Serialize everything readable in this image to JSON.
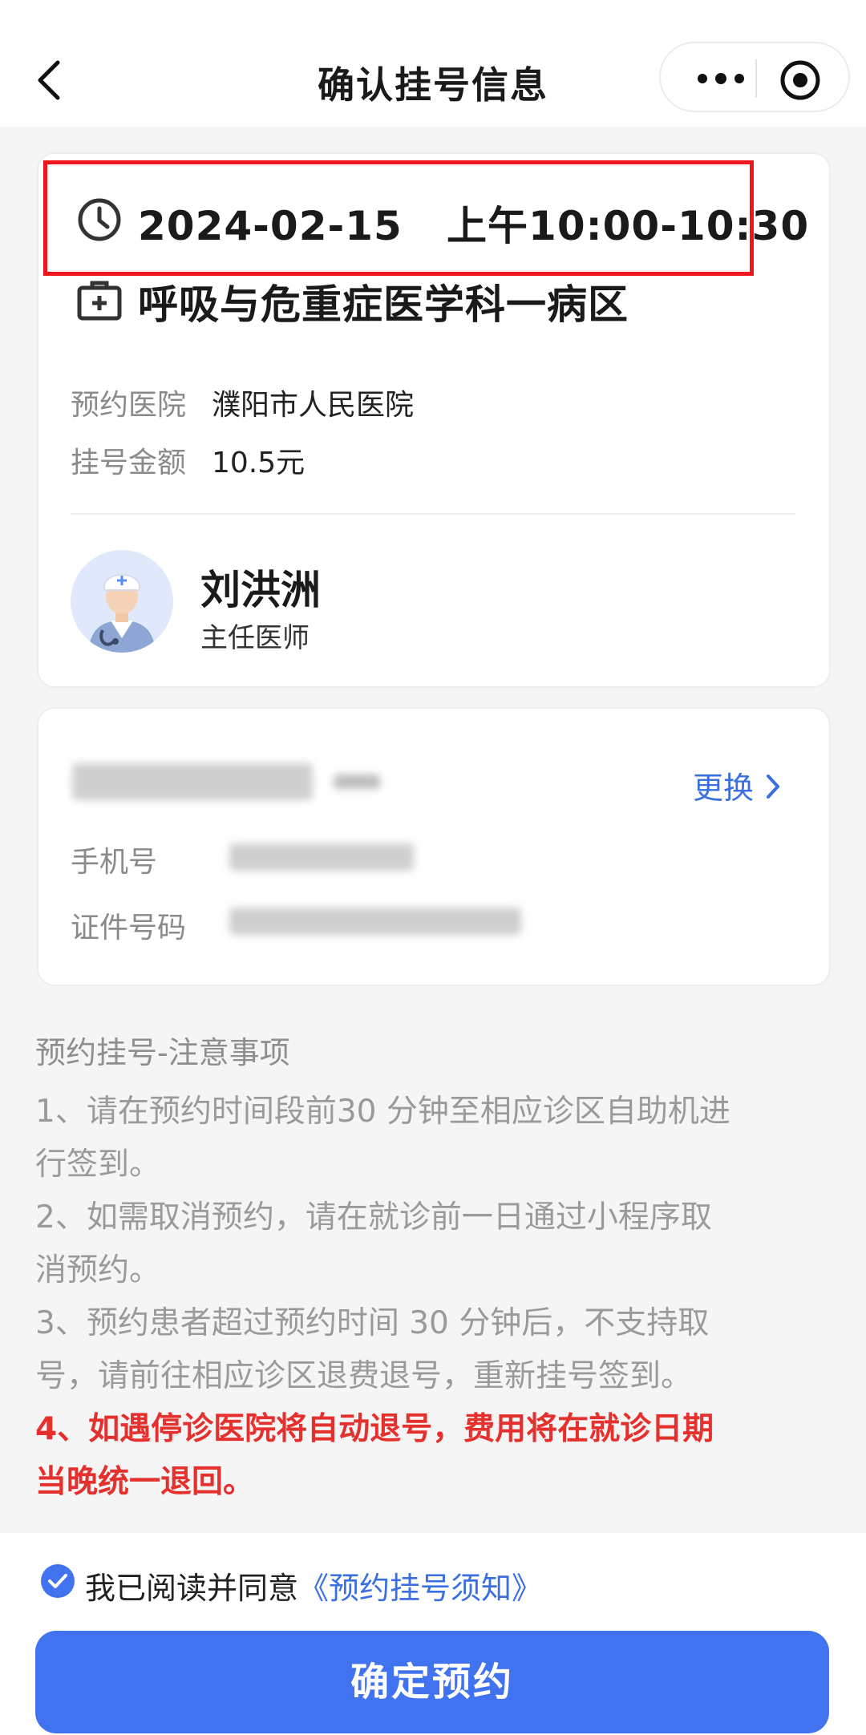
{
  "nav": {
    "title": "确认挂号信息"
  },
  "appointment": {
    "time": "2024-02-15   上午10:00-10:30",
    "department": "呼吸与危重症医学科一病区",
    "hospital_label": "预约医院",
    "hospital_value": "濮阳市人民医院",
    "fee_label": "挂号金额",
    "fee_value": "10.5元"
  },
  "doctor": {
    "name": "刘洪洲",
    "title": "主任医师"
  },
  "patient": {
    "change_label": "更换",
    "phone_label": "手机号",
    "id_label": "证件号码"
  },
  "notice": {
    "title": "预约挂号-注意事项",
    "items": [
      "1、请在预约时间段前30 分钟至相应诊区自助机进",
      "行签到。",
      "2、如需取消预约，请在就诊前一日通过小程序取",
      "消预约。",
      "3、预约患者超过预约时间 30 分钟后，不支持取",
      "号，请前往相应诊区退费退号，重新挂号签到。",
      "4、如遇停诊医院将自动退号，费用将在就诊日期",
      "当晚统一退回。"
    ]
  },
  "footer": {
    "agree_text": "我已阅读并同意",
    "agree_link": "《预约挂号须知》",
    "confirm_label": "确定预约"
  },
  "colors": {
    "accent": "#4172f0",
    "link": "#3b6fe0",
    "warning": "#e5312e",
    "highlight_border": "#f0141c"
  }
}
